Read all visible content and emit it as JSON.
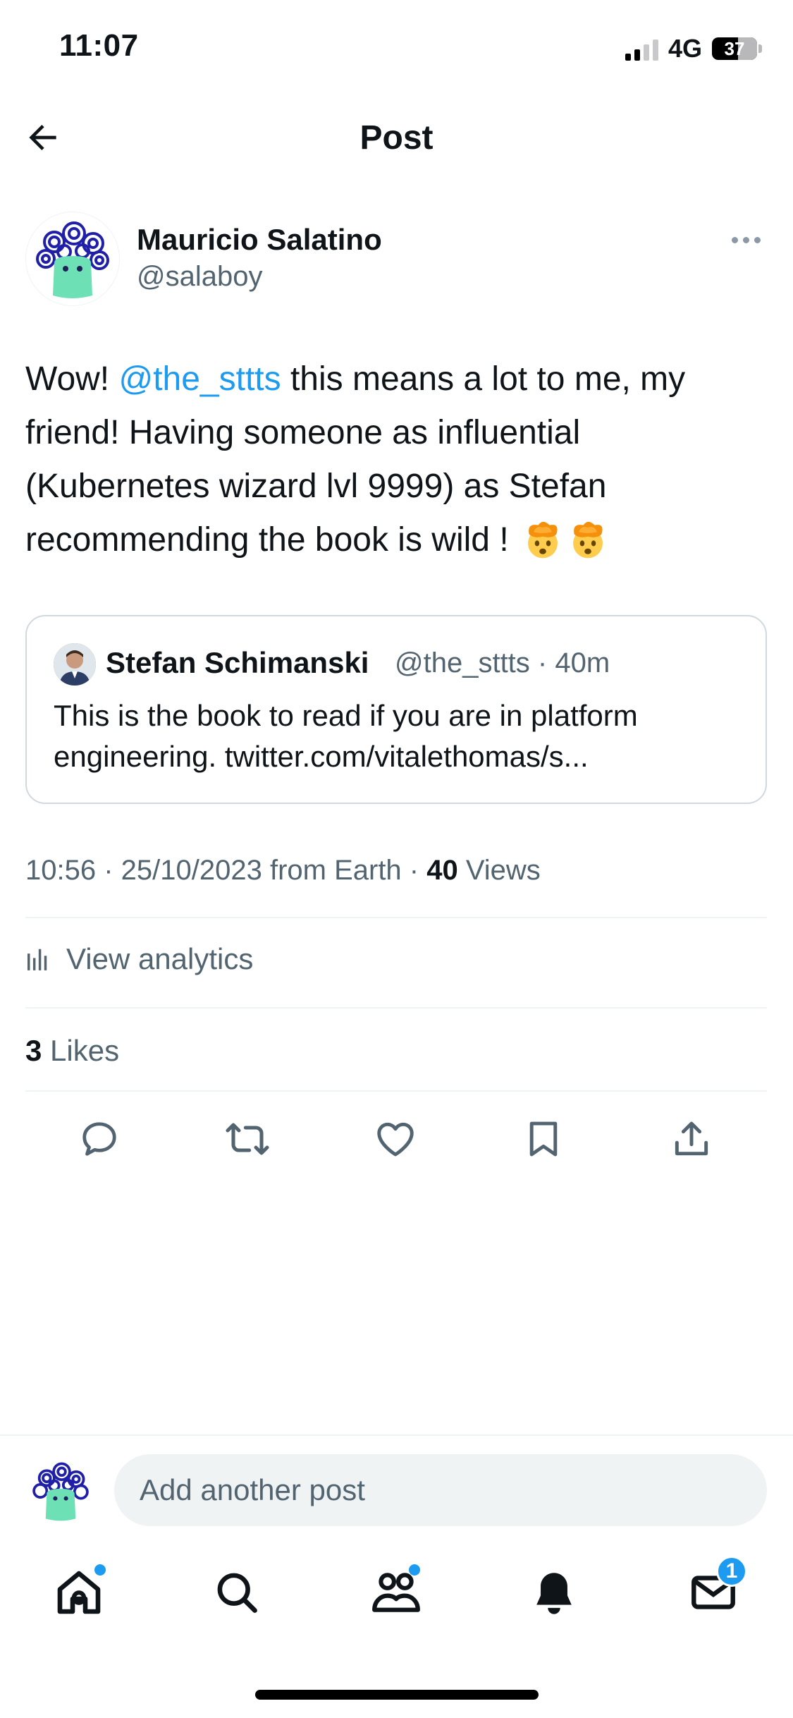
{
  "status_bar": {
    "time": "11:07",
    "network": "4G",
    "battery": "37",
    "signal_bars_active": 2,
    "signal_bars_total": 4
  },
  "header": {
    "title": "Post"
  },
  "author": {
    "name": "Mauricio Salatino",
    "handle": "@salaboy"
  },
  "post": {
    "prefix": "Wow! ",
    "mention": "@the_sttts",
    "body": " this means a lot to me, my friend! Having someone as influential (Kubernetes wizard lvl 9999) as Stefan recommending the book is wild ! ",
    "emoji": [
      "exploding-head",
      "exploding-head"
    ]
  },
  "quote": {
    "name": "Stefan Schimanski",
    "handle_time": "@the_sttts · 40m",
    "text": "This is the book to read if you are in platform engineering. twitter.com/vitalethomas/s..."
  },
  "meta": {
    "timestamp": "10:56 · 25/10/2023 from Earth · ",
    "views_count": "40",
    "views_label": " Views"
  },
  "analytics": {
    "label": "View analytics"
  },
  "likes": {
    "count": "3",
    "label": " Likes"
  },
  "actions": [
    "reply-icon",
    "retweet-icon",
    "like-icon",
    "bookmark-icon",
    "share-icon"
  ],
  "composer": {
    "placeholder": "Add another post"
  },
  "tab_bar": {
    "messages_badge": "1"
  },
  "colors": {
    "accent": "#1d9bf0",
    "text": "#0f1419",
    "secondary": "#536471",
    "border": "#cfd9de"
  }
}
